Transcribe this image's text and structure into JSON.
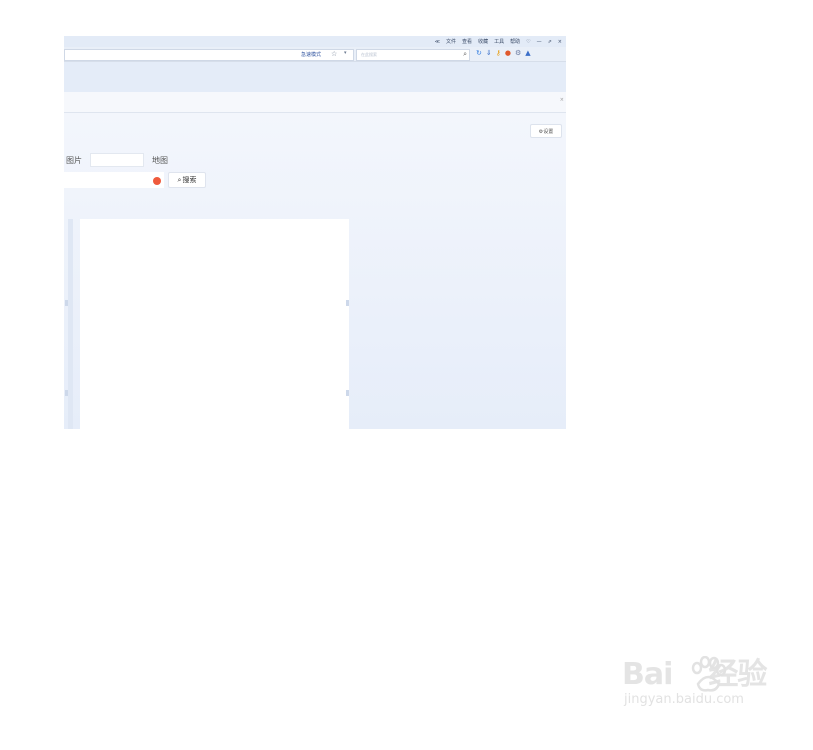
{
  "menubar": {
    "items": [
      "文件",
      "查看",
      "收藏",
      "工具",
      "帮助"
    ],
    "window_controls": [
      "—",
      "×"
    ]
  },
  "addressbar": {
    "kernel_label": "急速模式",
    "star_icon": "☆",
    "dropdown_icon": "▾"
  },
  "search": {
    "placeholder": "在此搜索",
    "icon": "search-icon"
  },
  "page": {
    "settings_label": "⚙设置",
    "nav_image_label": "图片",
    "nav_map_label": "地图",
    "search_button_label": "搜索"
  },
  "watermark": {
    "logo_text": "Bai",
    "logo_text2": "经验",
    "url_text": "jingyan.baidu.com"
  },
  "colors": {
    "accent": "#3356a0",
    "clear_icon": "#ef5a3c",
    "background": "#eef3fb"
  }
}
